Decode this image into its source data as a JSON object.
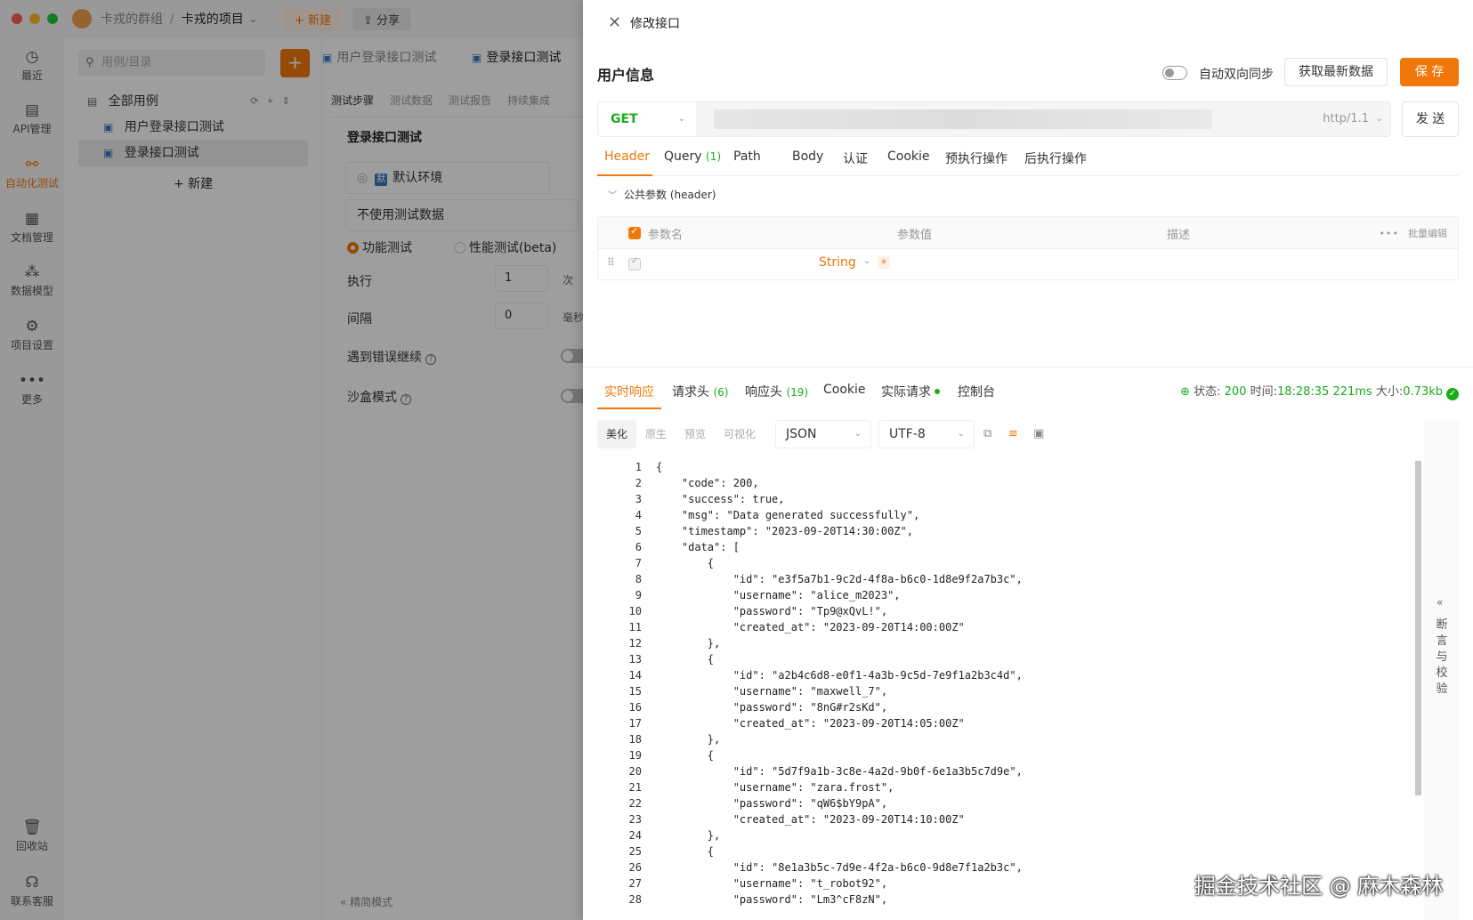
{
  "window": {
    "group": "卡戎的群组",
    "project": "卡戎的项目",
    "new_label": "+ 新建",
    "share_label": "分享"
  },
  "nav": {
    "items": [
      {
        "label": "最近",
        "icon": "clock-icon"
      },
      {
        "label": "API管理",
        "icon": "api-icon"
      },
      {
        "label": "自动化测试",
        "icon": "automation-icon"
      },
      {
        "label": "文档管理",
        "icon": "document-icon"
      },
      {
        "label": "数据模型",
        "icon": "data-model-icon"
      },
      {
        "label": "项目设置",
        "icon": "settings-icon"
      },
      {
        "label": "更多",
        "icon": "more-icon"
      }
    ],
    "trash": "回收站",
    "support": "联系客服"
  },
  "tree": {
    "search_placeholder": "用例/目录",
    "root": "全部用例",
    "cases": [
      "用户登录接口测试",
      "登录接口测试"
    ],
    "new_label": "+ 新建"
  },
  "mid": {
    "tabs": [
      "用户登录接口测试",
      "登录接口测试"
    ],
    "subtabs": [
      "测试步骤",
      "测试数据",
      "测试报告",
      "持续集成"
    ],
    "title": "登录接口测试",
    "env": "默认环境",
    "env_tag": "默",
    "test_data": "不使用测试数据",
    "mode_functional": "功能测试",
    "mode_perf": "性能测试(beta)",
    "exec_label": "执行",
    "exec_value": "1",
    "exec_unit": "次",
    "interval_label": "间隔",
    "interval_value": "0",
    "interval_unit": "毫秒",
    "on_error": "遇到错误继续",
    "sandbox": "沙盒模式",
    "footer": "精简模式"
  },
  "drawer": {
    "title": "修改接口",
    "name": "用户信息",
    "sync_label": "自动双向同步",
    "fetch_label": "获取最新数据",
    "save_label": "保 存",
    "method": "GET",
    "http_version": "http/1.1",
    "send_label": "发 送",
    "req_tabs": [
      {
        "label": "Header",
        "count": ""
      },
      {
        "label": "Query",
        "count": "(1)"
      },
      {
        "label": "Path",
        "count": ""
      },
      {
        "label": "Body",
        "count": ""
      },
      {
        "label": "认证",
        "count": ""
      },
      {
        "label": "Cookie",
        "count": ""
      },
      {
        "label": "预执行操作",
        "count": ""
      },
      {
        "label": "后执行操作",
        "count": ""
      }
    ],
    "public_params": "公共参数 (header)",
    "param_table": {
      "col_name": "参数名",
      "col_value": "参数值",
      "col_desc": "描述",
      "batch_edit": "批量编辑",
      "row_type": "String"
    },
    "res_tabs": [
      {
        "label": "实时响应",
        "count": ""
      },
      {
        "label": "请求头",
        "count": "(6)"
      },
      {
        "label": "响应头",
        "count": "(19)"
      },
      {
        "label": "Cookie",
        "count": ""
      },
      {
        "label": "实际请求",
        "count": ""
      },
      {
        "label": "控制台",
        "count": ""
      }
    ],
    "status": {
      "status_label": "状态:",
      "status_value": "200",
      "time_label": "时间:",
      "time_value": "18:28:35",
      "duration": "221ms",
      "size_label": "大小:",
      "size_value": "0.73kb"
    },
    "view_tabs": [
      "美化",
      "原生",
      "预览",
      "可视化"
    ],
    "format": "JSON",
    "encoding": "UTF-8",
    "assert_label": "断言与校验",
    "code_lines": [
      "{",
      "    \"code\": 200,",
      "    \"success\": true,",
      "    \"msg\": \"Data generated successfully\",",
      "    \"timestamp\": \"2023-09-20T14:30:00Z\",",
      "    \"data\": [",
      "        {",
      "            \"id\": \"e3f5a7b1-9c2d-4f8a-b6c0-1d8e9f2a7b3c\",",
      "            \"username\": \"alice_m2023\",",
      "            \"password\": \"Tp9@xQvL!\",",
      "            \"created_at\": \"2023-09-20T14:00:00Z\"",
      "        },",
      "        {",
      "            \"id\": \"a2b4c6d8-e0f1-4a3b-9c5d-7e9f1a2b3c4d\",",
      "            \"username\": \"maxwell_7\",",
      "            \"password\": \"8nG#r2sKd\",",
      "            \"created_at\": \"2023-09-20T14:05:00Z\"",
      "        },",
      "        {",
      "            \"id\": \"5d7f9a1b-3c8e-4a2d-9b0f-6e1a3b5c7d9e\",",
      "            \"username\": \"zara.frost\",",
      "            \"password\": \"qW6$bY9pA\",",
      "            \"created_at\": \"2023-09-20T14:10:00Z\"",
      "        },",
      "        {",
      "            \"id\": \"8e1a3b5c-7d9e-4f2a-b6c0-9d8e7f1a2b3c\",",
      "            \"username\": \"t_robot92\",",
      "            \"password\": \"Lm3^cF8zN\","
    ]
  },
  "watermark": "掘金技术社区 @ 麻木森林"
}
